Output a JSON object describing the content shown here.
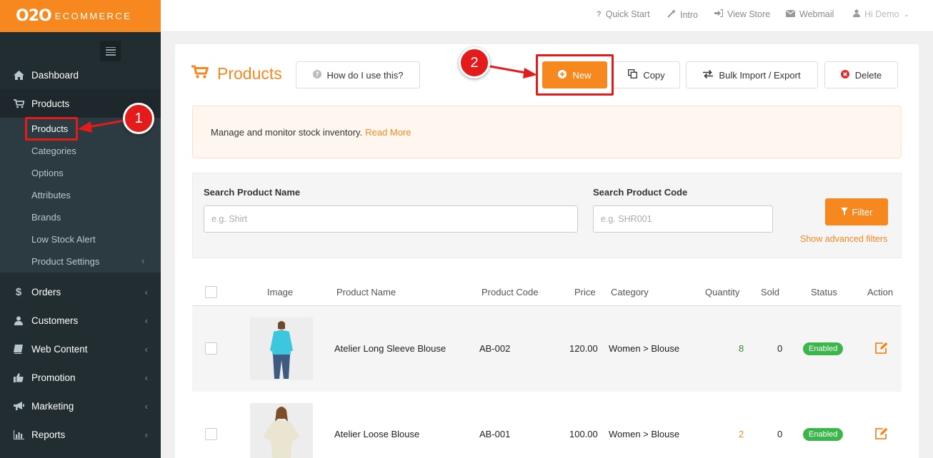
{
  "brand": {
    "logo": "O2O",
    "sub": "ECOMMERCE",
    "color": "#f7881f"
  },
  "sidebar": {
    "items": [
      {
        "label": "Dashboard",
        "icon": "home-icon"
      },
      {
        "label": "Products",
        "icon": "cart-icon"
      },
      {
        "label": "Orders",
        "icon": "dollar-icon"
      },
      {
        "label": "Customers",
        "icon": "user-icon"
      },
      {
        "label": "Web Content",
        "icon": "book-icon"
      },
      {
        "label": "Promotion",
        "icon": "thumbs-up-icon"
      },
      {
        "label": "Marketing",
        "icon": "bullhorn-icon"
      },
      {
        "label": "Reports",
        "icon": "bar-chart-icon"
      }
    ],
    "sub_items": [
      {
        "label": "Products"
      },
      {
        "label": "Categories"
      },
      {
        "label": "Options"
      },
      {
        "label": "Attributes"
      },
      {
        "label": "Brands"
      },
      {
        "label": "Low Stock Alert"
      },
      {
        "label": "Product Settings"
      }
    ]
  },
  "topbar": {
    "links": [
      {
        "label": "Quick Start",
        "icon": "question-icon"
      },
      {
        "label": "Intro",
        "icon": "magic-wand-icon"
      },
      {
        "label": "View Store",
        "icon": "sign-in-icon"
      },
      {
        "label": "Webmail",
        "icon": "envelope-icon"
      },
      {
        "label": "Hi Demo",
        "icon": "user-icon"
      }
    ]
  },
  "page": {
    "title": "Products",
    "help_button": "How do I use this?",
    "new_button": "New",
    "copy_button": "Copy",
    "import_button": "Bulk Import / Export",
    "delete_button": "Delete",
    "info_text": "Manage and monitor stock inventory.",
    "info_link": "Read More"
  },
  "filters": {
    "name_label": "Search Product Name",
    "name_placeholder": "e.g. Shirt",
    "code_label": "Search Product Code",
    "code_placeholder": "e.g. SHR001",
    "filter_button": "Filter",
    "advanced_link": "Show advanced filters"
  },
  "table": {
    "headers": [
      "Image",
      "Product Name",
      "Product Code",
      "Price",
      "Category",
      "Quantity",
      "Sold",
      "Status",
      "Action"
    ],
    "rows": [
      {
        "name": "Atelier Long Sleeve Blouse",
        "code": "AB-002",
        "price": "120.00",
        "category": "Women > Blouse",
        "quantity": "8",
        "quantity_color": "#3a8a2e",
        "sold": "0",
        "status": "Enabled"
      },
      {
        "name": "Atelier Loose Blouse",
        "code": "AB-001",
        "price": "100.00",
        "category": "Women > Blouse",
        "quantity": "2",
        "quantity_color": "#f7881f",
        "sold": "0",
        "status": "Enabled"
      }
    ]
  },
  "annotations": {
    "step1": "1",
    "step2": "2",
    "color": "#e31b1b"
  }
}
